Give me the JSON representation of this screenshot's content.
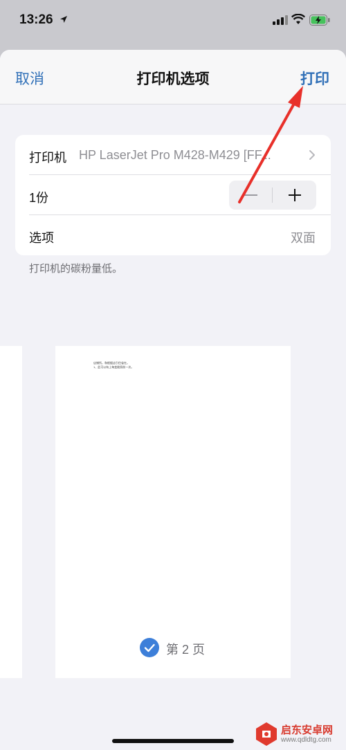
{
  "status_bar": {
    "time": "13:26"
  },
  "nav": {
    "cancel": "取消",
    "title": "打印机选项",
    "print": "打印"
  },
  "card": {
    "printer_label": "打印机",
    "printer_value": "HP LaserJet Pro M428-M429 [FF...",
    "copies_label": "1份",
    "options_label": "选项",
    "options_value": "双面"
  },
  "footnote": "打印机的碳粉量低。",
  "preview": {
    "line1": "店铺所，和根据店引住省在。",
    "line2": "1、此可以有上每变能照前一次。",
    "page_label": "第 2 页"
  },
  "watermark": {
    "name": "启东安卓网",
    "url": "www.qdldtg.com"
  },
  "colors": {
    "accent": "#2f6fb7",
    "arrow": "#e8302a",
    "check": "#3d7fd9"
  }
}
